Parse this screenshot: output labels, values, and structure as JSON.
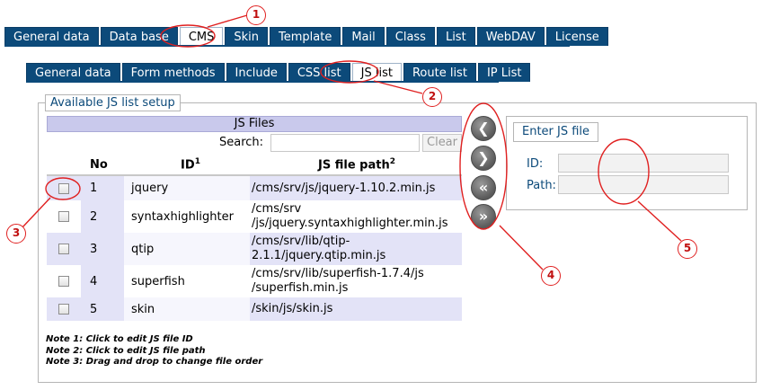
{
  "main_tabs": [
    "General data",
    "Data base",
    "CMS",
    "Skin",
    "Template",
    "Mail",
    "Class",
    "List",
    "WebDAV",
    "License"
  ],
  "main_active": "CMS",
  "sub_tabs": [
    "General data",
    "Form methods",
    "Include",
    "CSS list",
    "JS list",
    "Route list",
    "IP List"
  ],
  "sub_active": "JS list",
  "legend": "Available JS list setup",
  "files": {
    "title": "JS Files",
    "search_label": "Search:",
    "search_value": "",
    "clear_label": "Clear",
    "columns": {
      "no": "No",
      "id": "ID",
      "id_sup": "1",
      "path": "JS file path",
      "path_sup": "2"
    },
    "rows": [
      {
        "no": "1",
        "id": "jquery",
        "path": "/cms/srv/js/jquery-1.10.2.min.js"
      },
      {
        "no": "2",
        "id": "syntaxhighlighter",
        "path": "/cms/srv\n/js/jquery.syntaxhighlighter.min.js"
      },
      {
        "no": "3",
        "id": "qtip",
        "path": "/cms/srv/lib/qtip-\n2.1.1/jquery.qtip.min.js"
      },
      {
        "no": "4",
        "id": "superfish",
        "path": "/cms/srv/lib/superfish-1.7.4/js\n/superfish.min.js"
      },
      {
        "no": "5",
        "id": "skin",
        "path": "/skin/js/skin.js"
      }
    ]
  },
  "notes": [
    "Note 1: Click to edit JS file ID",
    "Note 2: Click to edit JS file path",
    "Note 3: Drag and drop to change file order"
  ],
  "arrows": [
    {
      "name": "move-left-button",
      "icon": "chevron-left-icon",
      "glyph": "❮"
    },
    {
      "name": "move-right-button",
      "icon": "chevron-right-icon",
      "glyph": "❯"
    },
    {
      "name": "move-all-left-button",
      "icon": "double-chevron-left-icon",
      "glyph": "«"
    },
    {
      "name": "move-all-right-button",
      "icon": "double-chevron-right-icon",
      "glyph": "»"
    }
  ],
  "entry": {
    "legend": "Enter JS file",
    "id_label": "ID:",
    "id_value": "",
    "path_label": "Path:",
    "path_value": ""
  },
  "callouts": [
    "1",
    "2",
    "3",
    "4",
    "5"
  ],
  "colors": {
    "tab_bg": "#0c4a7a",
    "header_bg": "#c9c9ec",
    "row_alt": "#e3e3f7",
    "annotation": "#e02020"
  }
}
